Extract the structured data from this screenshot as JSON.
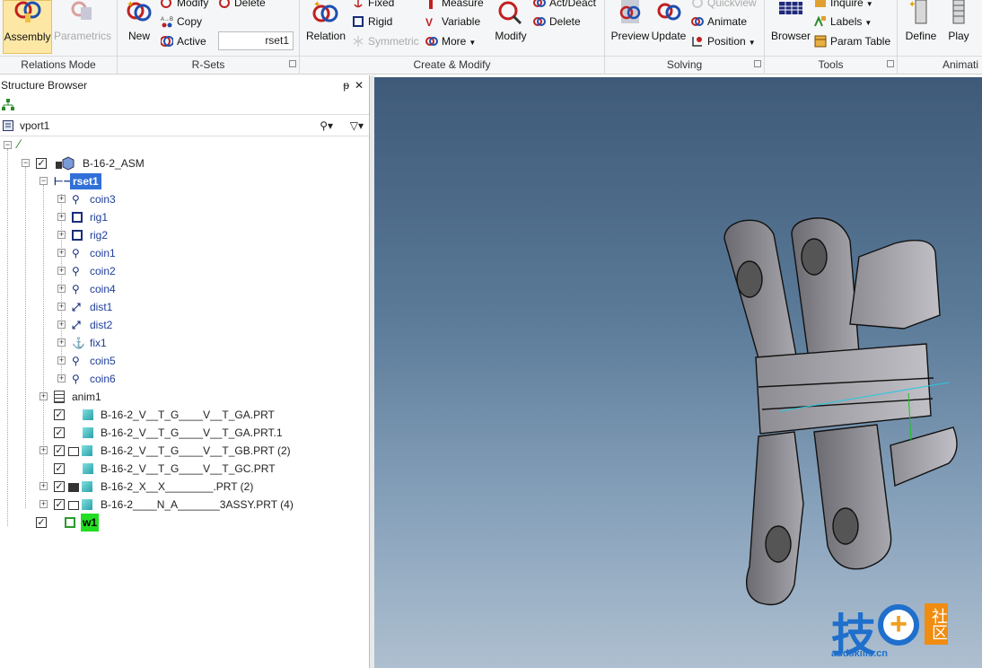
{
  "ribbon": {
    "groups": [
      "Relations Mode",
      "R-Sets",
      "Create & Modify",
      "Solving",
      "Tools",
      "Animati"
    ],
    "assembly": "Assembly",
    "parametrics": "Parametrics",
    "new": "New",
    "modify_rs": "Modify",
    "delete_rs": "Delete",
    "copy": "Copy",
    "active": "Active",
    "rset_value": "rset1",
    "relation": "Relation",
    "fixed": "Fixed",
    "rigid": "Rigid",
    "symmetric": "Symmetric",
    "measure": "Measure",
    "variable": "Variable",
    "more": "More",
    "modify": "Modify",
    "actdeact": "Act/Deact",
    "delete": "Delete",
    "preview": "Preview",
    "update": "Update",
    "quickview": "Quickview",
    "animate": "Animate",
    "position": "Position",
    "browser": "Browser",
    "inquire": "Inquire",
    "labels": "Labels",
    "paramtable": "Param Table",
    "define": "Define",
    "play": "Play"
  },
  "panel": {
    "title": "Structure Browser",
    "pin": "ᵽ",
    "close": "✕",
    "vport": "vport1"
  },
  "tree": {
    "root": "B-16-2_ASM",
    "rset": "rset1",
    "relations": [
      "coin3",
      "rig1",
      "rig2",
      "coin1",
      "coin2",
      "coin4",
      "dist1",
      "dist2",
      "fix1",
      "coin5",
      "coin6"
    ],
    "anim": "anim1",
    "parts": [
      "B-16-2_V__T_G____V__T_GA.PRT",
      "B-16-2_V__T_G____V__T_GA.PRT.1",
      "B-16-2_V__T_G____V__T_GB.PRT (2)",
      "B-16-2_V__T_G____V__T_GC.PRT",
      "B-16-2_X__X________.PRT (2)",
      "B-16-2____N_A_______3ASSY.PRT (4)"
    ],
    "w1": "w1"
  },
  "watermark": {
    "char": "技",
    "char2": "社区",
    "url": "addskills.cn"
  }
}
